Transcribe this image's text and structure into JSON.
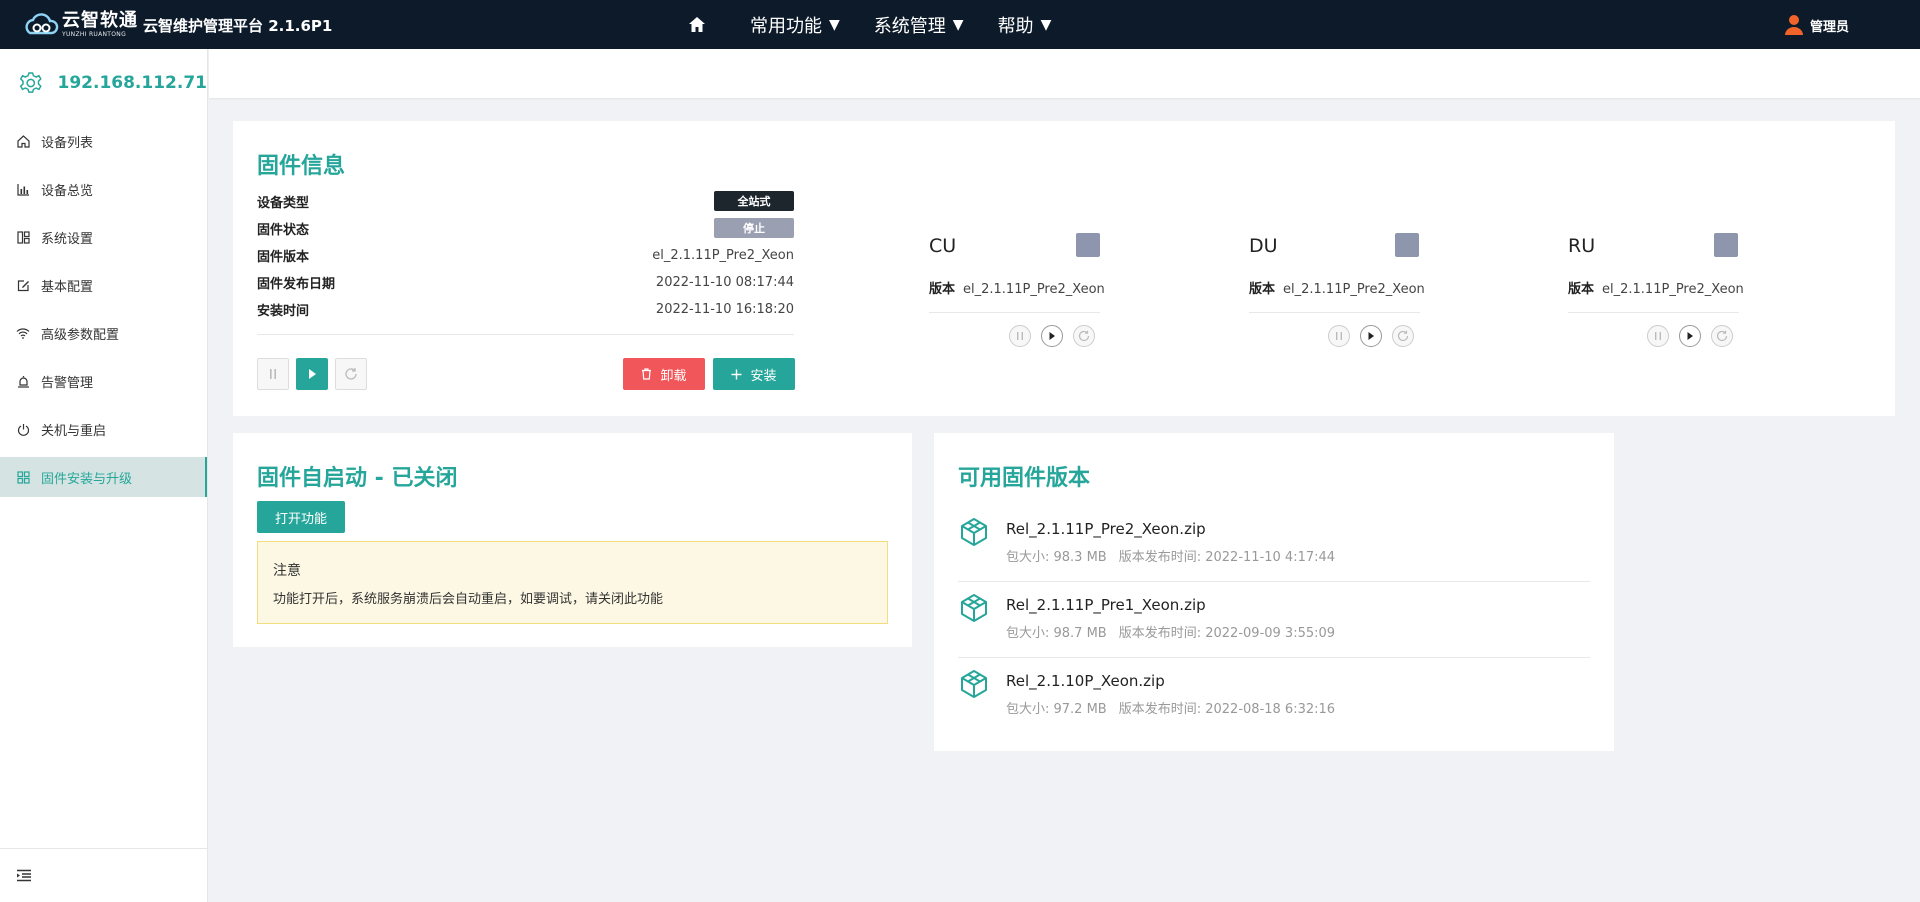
{
  "brand": {
    "logo_cn": "云智软通",
    "logo_en": "YUNZHI RUANTONG",
    "app_title": "云智维护管理平台 2.1.6P1"
  },
  "nav": {
    "home_icon": "home-icon",
    "items": [
      {
        "label": "常用功能"
      },
      {
        "label": "系统管理"
      },
      {
        "label": "帮助"
      }
    ],
    "user": "管理员"
  },
  "sidebar": {
    "ip": "192.168.112.71",
    "items": [
      {
        "label": "设备列表",
        "icon": "home-icon"
      },
      {
        "label": "设备总览",
        "icon": "bar-chart-icon"
      },
      {
        "label": "系统设置",
        "icon": "grid-icon"
      },
      {
        "label": "基本配置",
        "icon": "edit-icon"
      },
      {
        "label": "高级参数配置",
        "icon": "wifi-icon"
      },
      {
        "label": "告警管理",
        "icon": "alarm-icon"
      },
      {
        "label": "关机与重启",
        "icon": "power-icon"
      },
      {
        "label": "固件安装与升级",
        "icon": "apps-icon",
        "active": true
      }
    ]
  },
  "firmware": {
    "title": "固件信息",
    "rows": [
      {
        "key": "设备类型",
        "value": "全站式"
      },
      {
        "key": "固件状态",
        "value": "停止"
      },
      {
        "key": "固件版本",
        "value": "el_2.1.11P_Pre2_Xeon"
      },
      {
        "key": "固件发布日期",
        "value": "2022-11-10 08:17:44"
      },
      {
        "key": "安装时间",
        "value": "2022-11-10 16:18:20"
      }
    ],
    "uninstall_label": "卸载",
    "install_label": "安装",
    "components": [
      {
        "name": "CU",
        "version_label": "版本",
        "version": "el_2.1.11P_Pre2_Xeon"
      },
      {
        "name": "DU",
        "version_label": "版本",
        "version": "el_2.1.11P_Pre2_Xeon"
      },
      {
        "name": "RU",
        "version_label": "版本",
        "version": "el_2.1.11P_Pre2_Xeon"
      }
    ]
  },
  "autostart": {
    "title": "固件自启动 - 已关闭",
    "button": "打开功能",
    "notice_title": "注意",
    "notice_body": "功能打开后，系统服务崩溃后会自动重启，如要调试，请关闭此功能"
  },
  "versions": {
    "title": "可用固件版本",
    "items": [
      {
        "name": "Rel_2.1.11P_Pre2_Xeon.zip",
        "size": "包大小: 98.3 MB",
        "date": "版本发布时间: 2022-11-10 4:17:44"
      },
      {
        "name": "Rel_2.1.11P_Pre1_Xeon.zip",
        "size": "包大小: 98.7 MB",
        "date": "版本发布时间: 2022-09-09 3:55:09"
      },
      {
        "name": "Rel_2.1.10P_Xeon.zip",
        "size": "包大小: 97.2 MB",
        "date": "版本发布时间: 2022-08-18 6:32:16"
      }
    ]
  },
  "colors": {
    "accent": "#26a69a",
    "topbar": "#0c1a2a",
    "danger": "#f0565a",
    "status_gray": "#9aa0b1"
  }
}
